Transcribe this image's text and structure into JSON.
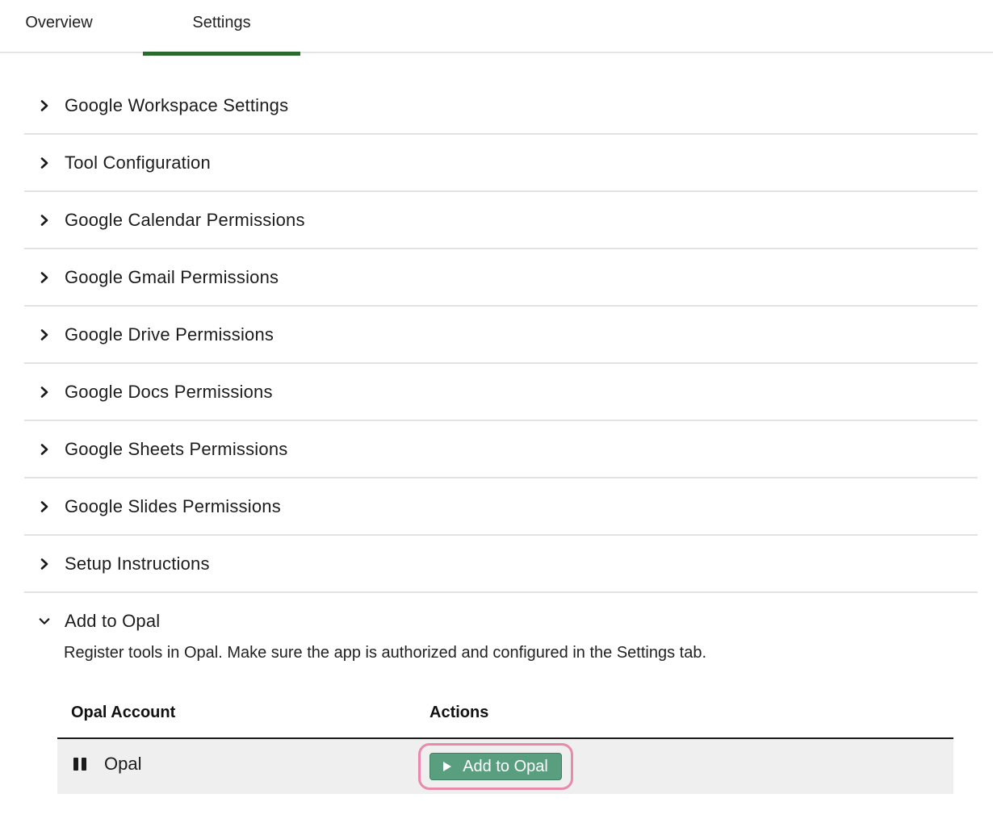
{
  "tabs": [
    {
      "label": "Overview",
      "active": false
    },
    {
      "label": "Settings",
      "active": true
    }
  ],
  "accent_color": "#2b6a2f",
  "accordion": {
    "collapsed_items": [
      {
        "label": "Google Workspace Settings"
      },
      {
        "label": "Tool Configuration"
      },
      {
        "label": "Google Calendar Permissions"
      },
      {
        "label": "Google Gmail Permissions"
      },
      {
        "label": "Google Drive Permissions"
      },
      {
        "label": "Google Docs Permissions"
      },
      {
        "label": "Google Sheets Permissions"
      },
      {
        "label": "Google Slides Permissions"
      },
      {
        "label": "Setup Instructions"
      }
    ],
    "open_item": {
      "label": "Add to Opal",
      "description": "Register tools in Opal. Make sure the app is authorized and configured in the Settings tab."
    }
  },
  "opal_table": {
    "headers": {
      "account": "Opal Account",
      "actions": "Actions"
    },
    "rows": [
      {
        "account": "Opal",
        "status_icon": "pause-icon",
        "action_label": "Add to Opal",
        "action_icon": "play-icon"
      }
    ]
  },
  "button_color": "#5a9e80",
  "highlight_color": "#ea8aa9"
}
